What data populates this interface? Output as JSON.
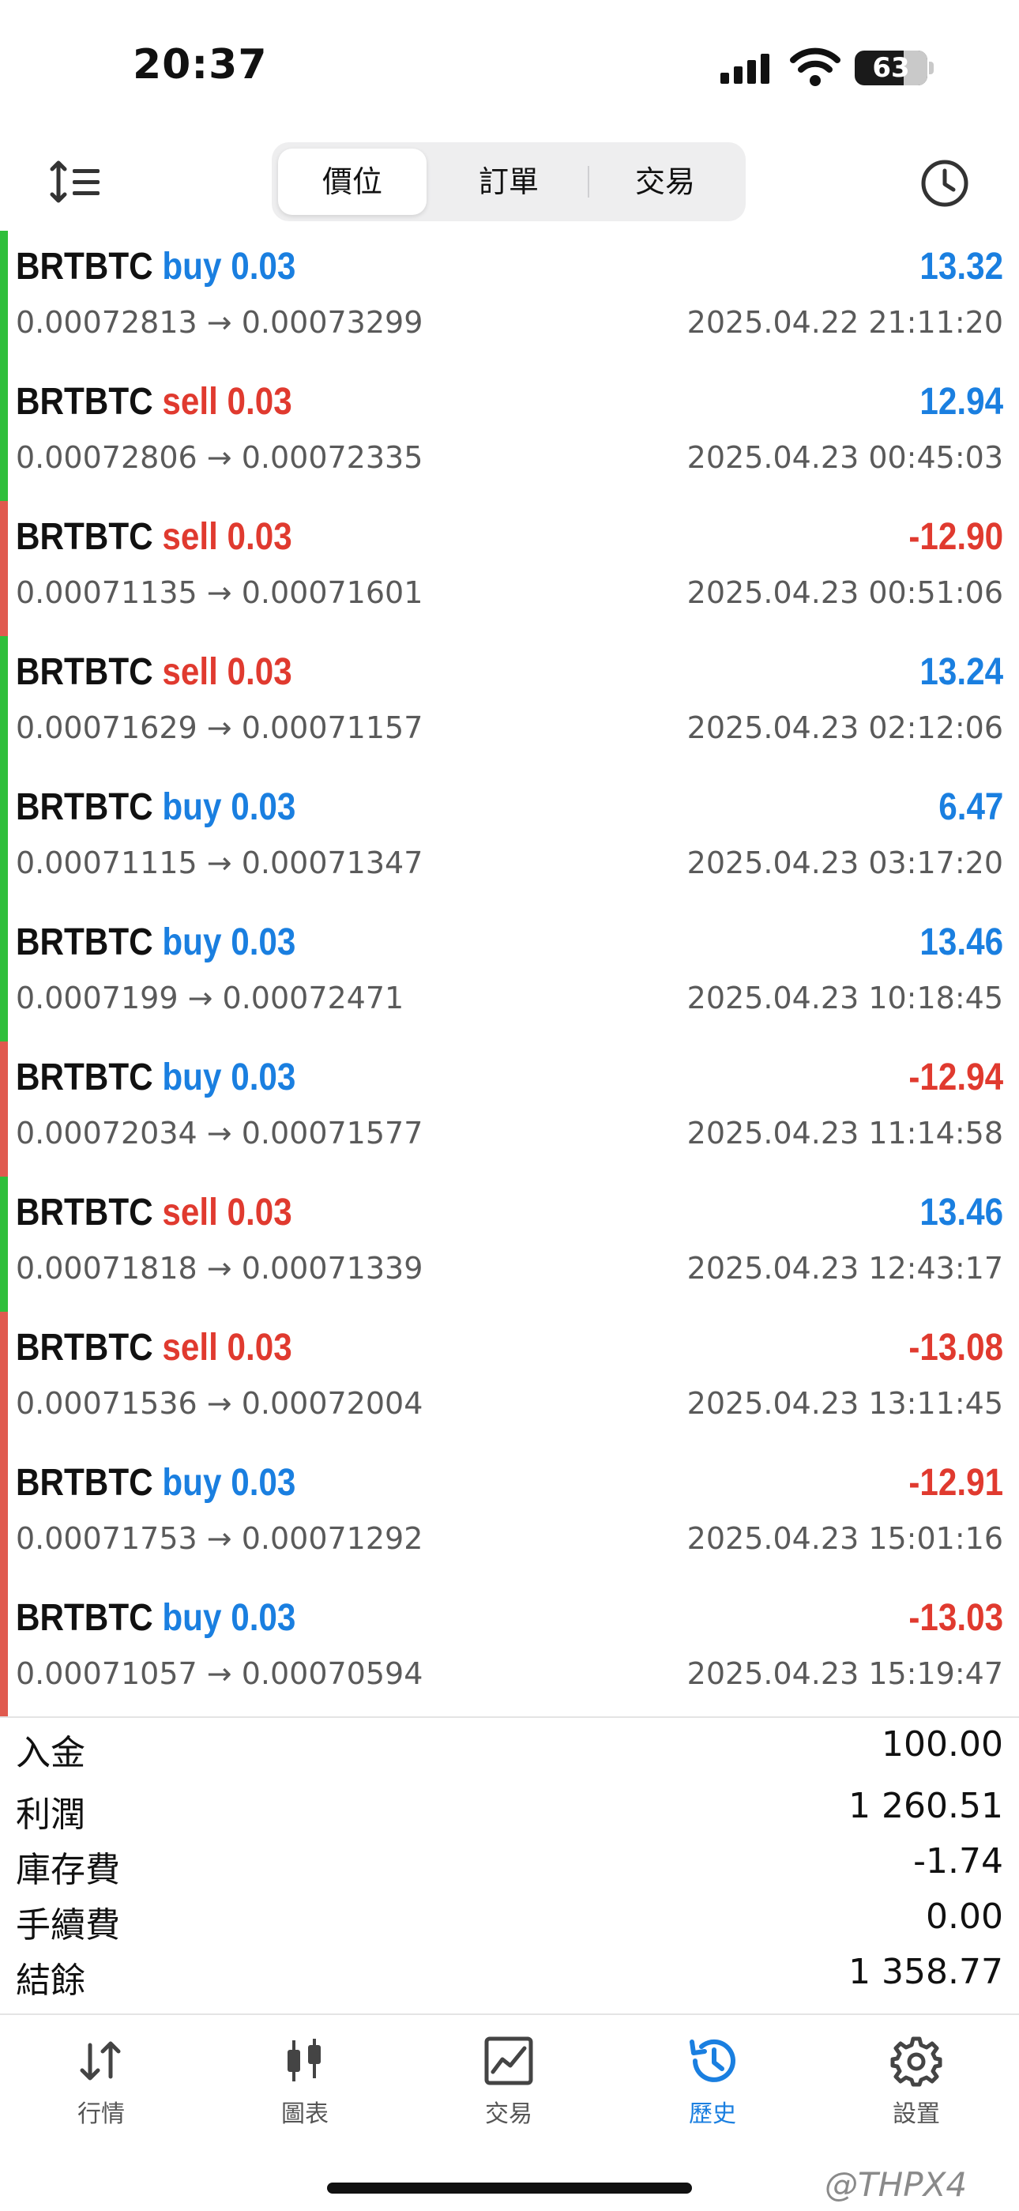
{
  "status": {
    "time": "20:37",
    "battery": "63"
  },
  "toolbar": {
    "tabs": [
      {
        "label": "價位"
      },
      {
        "label": "訂單"
      },
      {
        "label": "交易"
      }
    ],
    "active": 0
  },
  "colors": {
    "blue": "#1a7fe0",
    "red": "#e03a2f",
    "green": "#2fbf3b",
    "barRed": "#e05a4f"
  },
  "trades": [
    {
      "symbol": "BRTBTC",
      "side": "buy",
      "volume": "0.03",
      "open": "0.00072813",
      "close": "0.00073299",
      "date": "2025.04.22 21:11:20",
      "profit": "13.32",
      "profit_color": "blue",
      "bar": "green"
    },
    {
      "symbol": "BRTBTC",
      "side": "sell",
      "volume": "0.03",
      "open": "0.00072806",
      "close": "0.00072335",
      "date": "2025.04.23 00:45:03",
      "profit": "12.94",
      "profit_color": "blue",
      "bar": "green"
    },
    {
      "symbol": "BRTBTC",
      "side": "sell",
      "volume": "0.03",
      "open": "0.00071135",
      "close": "0.00071601",
      "date": "2025.04.23 00:51:06",
      "profit": "-12.90",
      "profit_color": "red",
      "bar": "red"
    },
    {
      "symbol": "BRTBTC",
      "side": "sell",
      "volume": "0.03",
      "open": "0.00071629",
      "close": "0.00071157",
      "date": "2025.04.23 02:12:06",
      "profit": "13.24",
      "profit_color": "blue",
      "bar": "green"
    },
    {
      "symbol": "BRTBTC",
      "side": "buy",
      "volume": "0.03",
      "open": "0.00071115",
      "close": "0.00071347",
      "date": "2025.04.23 03:17:20",
      "profit": "6.47",
      "profit_color": "blue",
      "bar": "green"
    },
    {
      "symbol": "BRTBTC",
      "side": "buy",
      "volume": "0.03",
      "open": "0.0007199",
      "close": "0.00072471",
      "date": "2025.04.23 10:18:45",
      "profit": "13.46",
      "profit_color": "blue",
      "bar": "green"
    },
    {
      "symbol": "BRTBTC",
      "side": "buy",
      "volume": "0.03",
      "open": "0.00072034",
      "close": "0.00071577",
      "date": "2025.04.23 11:14:58",
      "profit": "-12.94",
      "profit_color": "red",
      "bar": "red"
    },
    {
      "symbol": "BRTBTC",
      "side": "sell",
      "volume": "0.03",
      "open": "0.00071818",
      "close": "0.00071339",
      "date": "2025.04.23 12:43:17",
      "profit": "13.46",
      "profit_color": "blue",
      "bar": "green"
    },
    {
      "symbol": "BRTBTC",
      "side": "sell",
      "volume": "0.03",
      "open": "0.00071536",
      "close": "0.00072004",
      "date": "2025.04.23 13:11:45",
      "profit": "-13.08",
      "profit_color": "red",
      "bar": "red"
    },
    {
      "symbol": "BRTBTC",
      "side": "buy",
      "volume": "0.03",
      "open": "0.00071753",
      "close": "0.00071292",
      "date": "2025.04.23 15:01:16",
      "profit": "-12.91",
      "profit_color": "red",
      "bar": "red"
    },
    {
      "symbol": "BRTBTC",
      "side": "buy",
      "volume": "0.03",
      "open": "0.00071057",
      "close": "0.00070594",
      "date": "2025.04.23 15:19:47",
      "profit": "-13.03",
      "profit_color": "red",
      "bar": "red"
    }
  ],
  "arrow": "→",
  "summary": [
    {
      "label": "入金",
      "value": "100.00"
    },
    {
      "label": "利潤",
      "value": "1 260.51"
    },
    {
      "label": "庫存費",
      "value": "-1.74"
    },
    {
      "label": "手續費",
      "value": "0.00"
    },
    {
      "label": "結餘",
      "value": "1 358.77"
    }
  ],
  "tabbar": [
    {
      "label": "行情",
      "icon": "quotes-arrows-icon"
    },
    {
      "label": "圖表",
      "icon": "candlestick-chart-icon"
    },
    {
      "label": "交易",
      "icon": "trade-chart-icon"
    },
    {
      "label": "歷史",
      "icon": "history-clock-icon"
    },
    {
      "label": "設置",
      "icon": "gear-icon"
    }
  ],
  "tabbar_active": 3,
  "watermark": "@THPX4"
}
